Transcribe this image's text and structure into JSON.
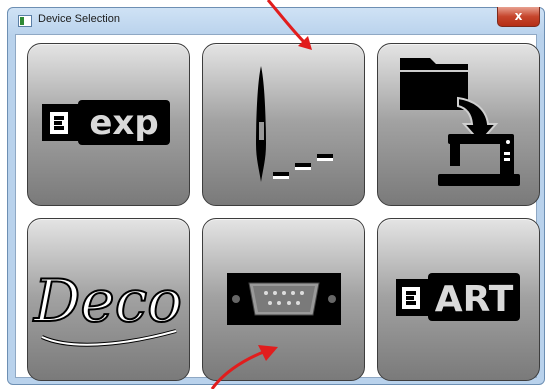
{
  "window": {
    "title": "Device Selection",
    "close_glyph": "x"
  },
  "tiles": [
    {
      "id": "exp",
      "icon": "usb-stick-exp-icon",
      "label": "exp"
    },
    {
      "id": "needle",
      "icon": "needle-stitch-icon",
      "label": ""
    },
    {
      "id": "folder-machine",
      "icon": "folder-to-sewing-machine-icon",
      "label": ""
    },
    {
      "id": "deco",
      "icon": "deco-logo-icon",
      "label": "Deco"
    },
    {
      "id": "serial",
      "icon": "serial-port-icon",
      "label": ""
    },
    {
      "id": "art",
      "icon": "usb-stick-art-icon",
      "label": "ART"
    }
  ],
  "colors": {
    "annotation_arrow": "#e11d1d",
    "tile_icon": "#000000"
  }
}
